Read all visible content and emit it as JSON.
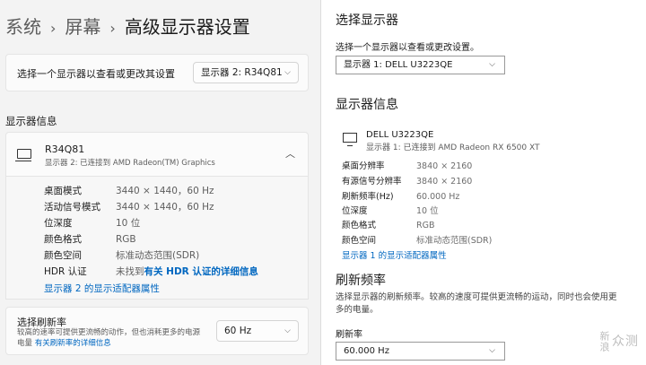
{
  "left": {
    "breadcrumb": [
      "系统",
      "屏幕",
      "高级显示器设置"
    ],
    "select_display": {
      "label": "选择一个显示器以查看或更改其设置",
      "value": "显示器 2: R34Q81"
    },
    "section_title": "显示器信息",
    "display": {
      "name": "R34Q81",
      "sub": "显示器 2: 已连接到 AMD Radeon(TM) Graphics",
      "rows": [
        {
          "k": "桌面模式",
          "v": "3440 × 1440，60 Hz"
        },
        {
          "k": "活动信号模式",
          "v": "3440 × 1440，60 Hz"
        },
        {
          "k": "位深度",
          "v": "10 位"
        },
        {
          "k": "颜色格式",
          "v": "RGB"
        },
        {
          "k": "颜色空间",
          "v": "标准动态范围(SDR)"
        }
      ],
      "hdr": {
        "k": "HDR 认证",
        "v": "未找到",
        "link": "有关 HDR 认证的详细信息"
      },
      "adapter_link": "显示器 2 的显示适配器属性"
    },
    "refresh": {
      "title": "选择刷新率",
      "desc": "较高的速率可提供更流畅的动作，但也消耗更多的电源电量",
      "link": "有关刷新率的详细信息",
      "value": "60 Hz"
    }
  },
  "right": {
    "select_title": "选择显示器",
    "select_label": "选择一个显示器以查看或更改设置。",
    "select_value": "显示器 1: DELL U3223QE",
    "info_title": "显示器信息",
    "display": {
      "name": "DELL U3223QE",
      "sub": "显示器 1: 已连接到 AMD Radeon RX 6500 XT",
      "rows": [
        {
          "k": "桌面分辨率",
          "v": "3840 × 2160"
        },
        {
          "k": "有源信号分辨率",
          "v": "3840 × 2160"
        },
        {
          "k": "刷新频率(Hz)",
          "v": "60.000 Hz"
        },
        {
          "k": "位深度",
          "v": "10 位"
        },
        {
          "k": "颜色格式",
          "v": "RGB"
        },
        {
          "k": "颜色空间",
          "v": "标准动态范围(SDR)"
        }
      ],
      "adapter_link": "显示器 1 的显示适配器属性"
    },
    "refresh_title": "刷新频率",
    "refresh_desc": "选择显示器的刷新频率。较高的速度可提供更流畅的运动，同时也会使用更多的电量。",
    "refresh_label": "刷新率",
    "refresh_value": "60.000 Hz"
  },
  "watermark": {
    "v": "新浪",
    "h": "众测"
  }
}
